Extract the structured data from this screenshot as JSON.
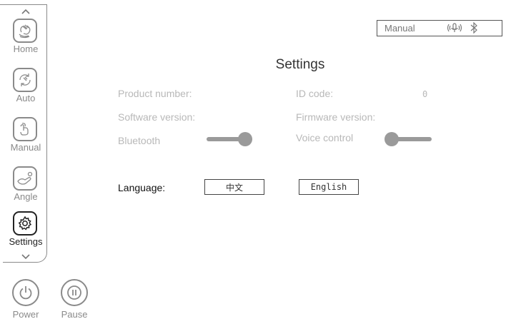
{
  "sidebar": {
    "items": [
      {
        "label": "Home",
        "icon": "hand-wave-icon"
      },
      {
        "label": "Auto",
        "icon": "auto-cycle-icon"
      },
      {
        "label": "Manual",
        "icon": "hand-touch-icon"
      },
      {
        "label": "Angle",
        "icon": "recline-angle-icon"
      },
      {
        "label": "Settings",
        "icon": "gear-icon"
      }
    ],
    "active": "Settings"
  },
  "controls": {
    "power_label": "Power",
    "pause_label": "Pause"
  },
  "status": {
    "mode": "Manual",
    "icons": [
      "voice-icon",
      "bluetooth-icon"
    ]
  },
  "page": {
    "title": "Settings",
    "product_number_label": "Product number:",
    "id_code_label": "ID code:",
    "id_code_value": "0",
    "software_version_label": "Software version:",
    "firmware_version_label": "Firmware version:",
    "bluetooth_label": "Bluetooth",
    "voice_control_label": "Voice control",
    "language_label": "Language:",
    "lang_chinese": "中文",
    "lang_english": "English"
  },
  "toggles": {
    "bluetooth": "on",
    "voice_control": "off"
  },
  "colors": {
    "border": "#8a8a8a",
    "active": "#222222",
    "muted_text": "#b8b8b8"
  }
}
